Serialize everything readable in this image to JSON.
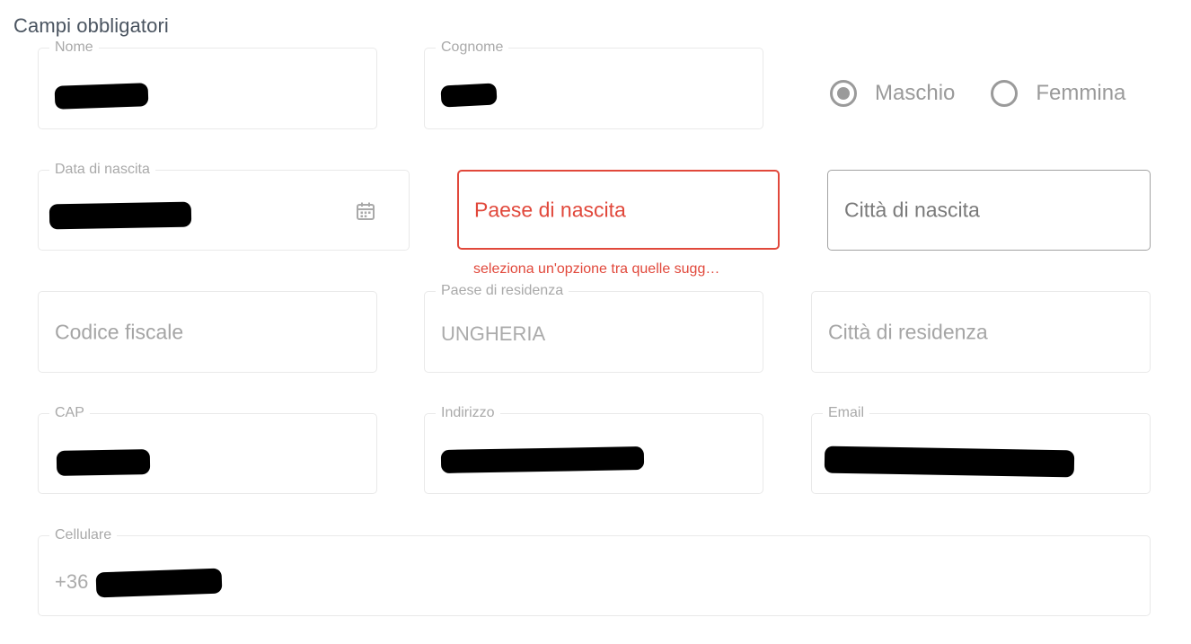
{
  "section": {
    "title": "Campi obbligatori"
  },
  "fields": {
    "nome": {
      "label": "Nome"
    },
    "cognome": {
      "label": "Cognome"
    },
    "data_nascita": {
      "label": "Data di nascita"
    },
    "paese_nascita": {
      "placeholder": "Paese di nascita",
      "error": "seleziona un'opzione tra quelle sugg…"
    },
    "citta_nascita": {
      "placeholder": "Città di nascita"
    },
    "codice_fiscale": {
      "placeholder": "Codice fiscale"
    },
    "paese_residenza": {
      "label": "Paese di residenza",
      "value": "UNGHERIA"
    },
    "citta_residenza": {
      "placeholder": "Città di residenza"
    },
    "cap": {
      "label": "CAP"
    },
    "indirizzo": {
      "label": "Indirizzo"
    },
    "email": {
      "label": "Email"
    },
    "cellulare": {
      "label": "Cellulare",
      "prefix": "+36"
    }
  },
  "gender": {
    "options": [
      {
        "label": "Maschio",
        "selected": true
      },
      {
        "label": "Femmina",
        "selected": false
      }
    ]
  },
  "colors": {
    "error": "#e1483b",
    "muted_text": "#a9a9a9",
    "border": "#e9e9e9",
    "title": "#4a5460"
  },
  "icons": {
    "date_picker": "calendar-icon"
  }
}
